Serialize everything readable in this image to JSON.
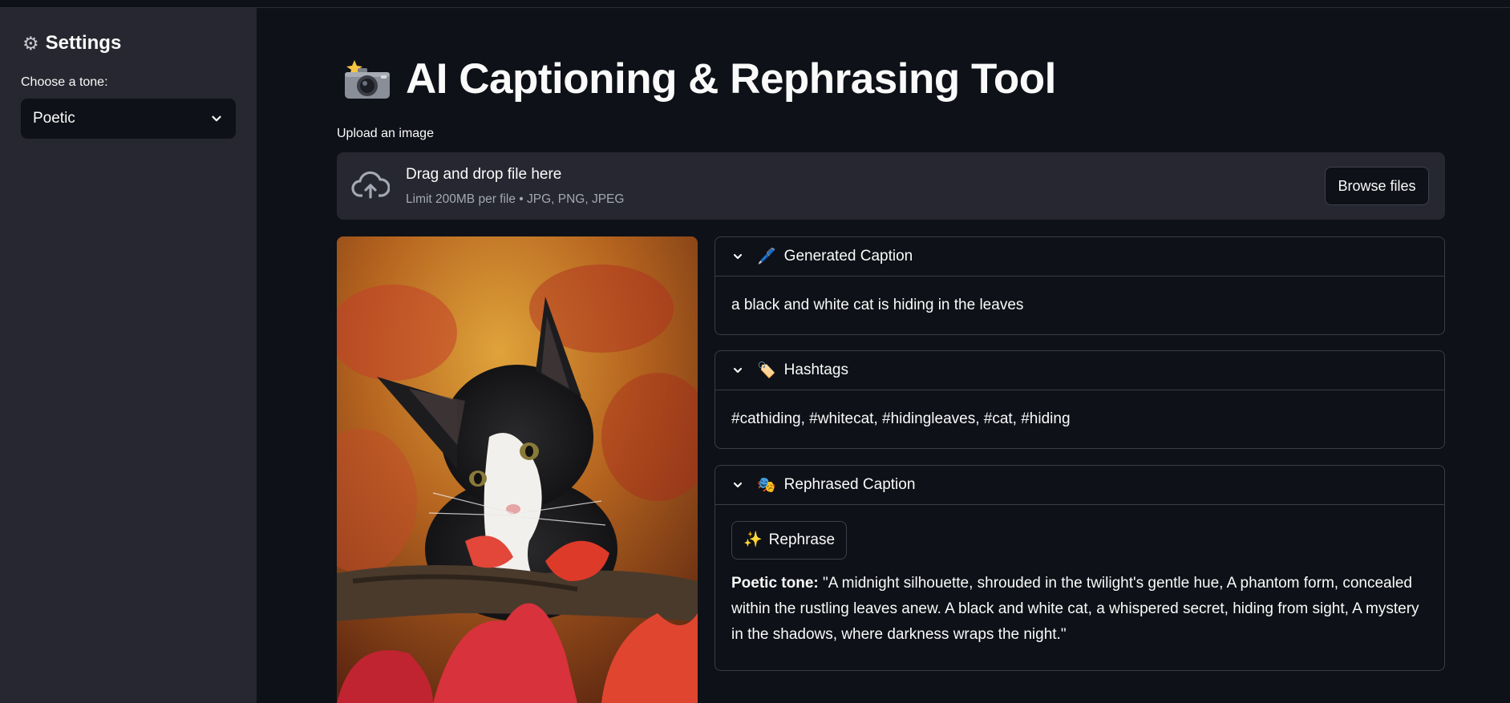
{
  "sidebar": {
    "title": "Settings",
    "tone_label": "Choose a tone:",
    "tone_selected": "Poetic"
  },
  "main": {
    "title": "AI Captioning & Rephrasing Tool",
    "upload_label": "Upload an image",
    "dropzone": {
      "title": "Drag and drop file here",
      "subtitle": "Limit 200MB per file • JPG, PNG, JPEG",
      "browse_label": "Browse files"
    }
  },
  "panels": {
    "caption": {
      "emoji": "🖊️",
      "title": "Generated Caption",
      "text": "a black and white cat is hiding in the leaves"
    },
    "hashtags": {
      "emoji": "🏷️",
      "title": "Hashtags",
      "text": "#cathiding, #whitecat, #hidingleaves, #cat, #hiding"
    },
    "rephrased": {
      "emoji": "🎭",
      "title": "Rephrased Caption",
      "button_emoji": "✨",
      "button_label": "Rephrase",
      "tone_prefix": "Poetic tone:",
      "text": " \"A midnight silhouette, shrouded in the twilight's gentle hue, A phantom form, concealed within the rustling leaves anew. A black and white cat, a whispered secret, hiding from sight, A mystery in the shadows, where darkness wraps the night.\""
    }
  },
  "icons": {
    "settings": "gear-icon",
    "camera": "camera-flash-icon",
    "upload": "cloud-upload-icon",
    "chevron": "chevron-down-icon"
  },
  "colors": {
    "background": "#0e1117",
    "sidebar": "#262730",
    "text": "#fafafa",
    "muted": "#a3a8b4",
    "border": "#3a3d47"
  }
}
